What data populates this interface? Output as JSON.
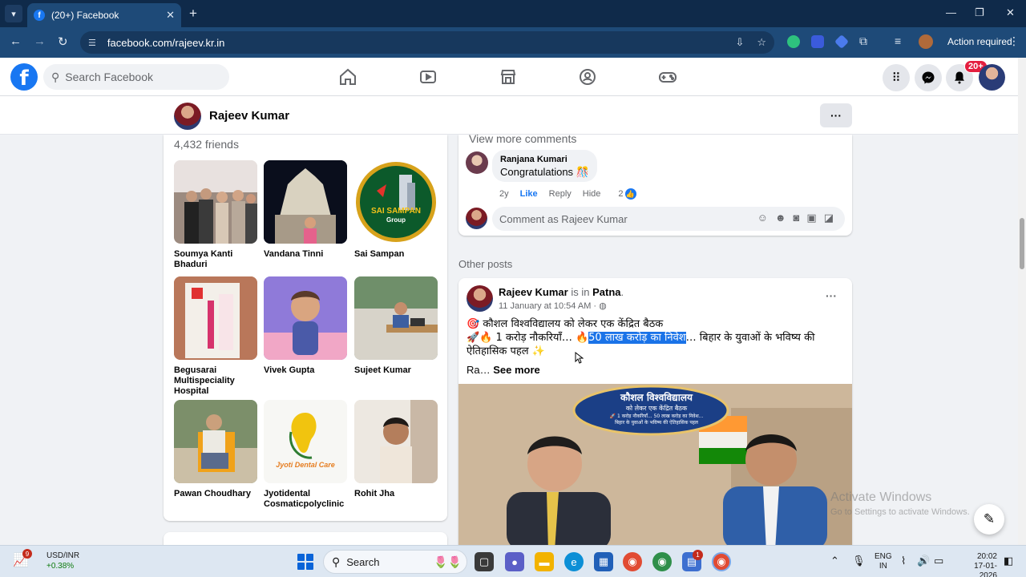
{
  "browser": {
    "tab_title": "(20+) Facebook",
    "url": "facebook.com/rajeev.kr.in",
    "action_required": "Action required"
  },
  "fb_header": {
    "search_placeholder": "Search Facebook",
    "notification_badge": "20+"
  },
  "profile": {
    "name": "Rajeev Kumar",
    "friends_count": "4,432 friends"
  },
  "friends": [
    {
      "name": "Soumya Kanti Bhaduri"
    },
    {
      "name": "Vandana Tinni"
    },
    {
      "name": "Sai Sampan"
    },
    {
      "name": "Begusarai Multispeciality Hospital"
    },
    {
      "name": "Vivek Gupta"
    },
    {
      "name": "Sujeet Kumar"
    },
    {
      "name": "Pawan Choudhary"
    },
    {
      "name": "Jyotidental Cosmaticpolyclinic"
    },
    {
      "name": "Rohit Jha"
    }
  ],
  "friend_logos": {
    "sai_sampan_line1": "SAI SAMPAN",
    "sai_sampan_line2": "Group",
    "jyoti": "Jyoti Dental Care"
  },
  "comments": {
    "view_more": "View more comments",
    "comment": {
      "author": "Ranjana Kumari",
      "text": "Congratulations 🎊",
      "age": "2y",
      "like": "Like",
      "reply": "Reply",
      "hide": "Hide",
      "reaction_count": "2"
    },
    "input_placeholder": "Comment as Rajeev Kumar"
  },
  "other_posts_label": "Other posts",
  "post": {
    "author": "Rajeev Kumar",
    "is_in": "is in",
    "location": "Patna",
    "date": "11 January at 10:54 AM ·",
    "line1": "🎯 कौशल विश्वविद्यालय को लेकर एक केंद्रित बैठक",
    "line2_pre": "🚀🔥 1 करोड़ नौकरियाँ… 🔥",
    "line2_sel": "50 लाख करोड़ का निवेश",
    "line2_post": "… बिहार के युवाओं के भविष्य की",
    "line3": "ऐतिहासिक पहल ✨",
    "ra": "Ra…",
    "see_more": "See more",
    "image_banner": {
      "title": "कौशल विश्वविद्यालय",
      "sub1": "को लेकर एक केंद्रित बैठक",
      "sub2": "🚀 1 करोड़ नौकरियाँ... 50 लाख करोड़ का निवेश...",
      "sub3": "बिहार के युवाओं के भविष्य की ऐतिहासिक पहल"
    }
  },
  "watermark": {
    "line1": "Activate Windows",
    "line2": "Go to Settings to activate Windows."
  },
  "taskbar": {
    "widget_title": "USD/INR",
    "widget_value": "+0.38%",
    "widget_badge": "9",
    "search_label": "Search",
    "app_badge": "1",
    "lang_top": "ENG",
    "lang_bottom": "IN",
    "time": "20:02",
    "date": "17-01-2026"
  },
  "colors": {
    "fb_blue": "#1877f2",
    "browser_frame": "#1e4a78",
    "selection": "#1a73e8"
  }
}
